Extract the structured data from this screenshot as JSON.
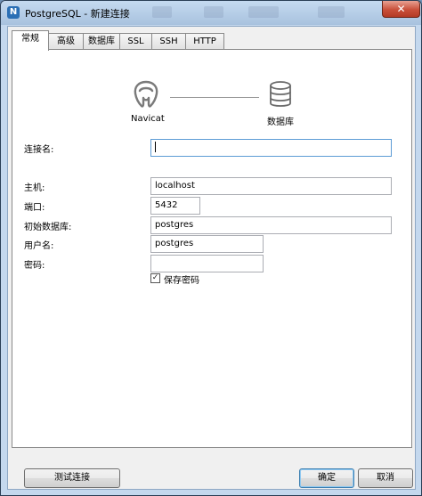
{
  "window": {
    "title": "PostgreSQL - 新建连接",
    "app_icon": "navicat-icon",
    "close_label": "✕"
  },
  "tabs": [
    {
      "label": "常规",
      "active": true
    },
    {
      "label": "高级"
    },
    {
      "label": "数据库"
    },
    {
      "label": "SSL"
    },
    {
      "label": "SSH"
    },
    {
      "label": "HTTP"
    }
  ],
  "graphic": {
    "left_label": "Navicat",
    "right_label": "数据库",
    "left_icon": "postgresql-elephant-icon",
    "right_icon": "database-icon"
  },
  "form": {
    "connection_name_label": "连接名:",
    "connection_name_value": "",
    "host_label": "主机:",
    "host_value": "localhost",
    "port_label": "端口:",
    "port_value": "5432",
    "initial_db_label": "初始数据库:",
    "initial_db_value": "postgres",
    "username_label": "用户名:",
    "username_value": "postgres",
    "password_label": "密码:",
    "password_value": "",
    "save_password_label": "保存密码",
    "save_password_checked": true
  },
  "buttons": {
    "test_connection": "测试连接",
    "ok": "确定",
    "cancel": "取消"
  }
}
